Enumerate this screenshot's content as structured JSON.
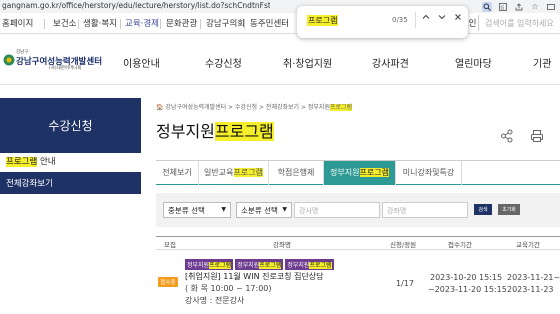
{
  "browser": {
    "url": "gangnam.go.kr/office/herstory/edu/lecture/herstory/list.do?schCndtnFstField=eci_crs_mlv&schCndtnFstValue=..."
  },
  "find_bar": {
    "query": "프로그램",
    "count": "0/35"
  },
  "top_nav": {
    "items": [
      "홈페이지",
      "보건소",
      "생활·복지",
      "교육·경제",
      "문화관광",
      "강남구의회",
      "동주민센터"
    ],
    "login": "로그인",
    "search_placeholder": "검색어를 입력하세요"
  },
  "logo": {
    "small": "강남구",
    "main": "강남구여성능력개발센터",
    "sub": "(사)대한어머니회"
  },
  "gnb": {
    "items": [
      "이용안내",
      "수강신청",
      "취·창업지원",
      "강사파견",
      "열린마당",
      "기관"
    ]
  },
  "sidebar": {
    "title": "수강신청",
    "items": [
      {
        "hl": "프로그램",
        "rest": " 안내"
      },
      {
        "label": "전체강좌보기"
      }
    ]
  },
  "breadcrumb": {
    "parts": [
      "강남구여성능력개발센터",
      "수강신청",
      "전체강좌보기",
      "정부지원"
    ],
    "hl": "프로그램"
  },
  "page": {
    "title_a": "정부지원",
    "title_b": "프로그램"
  },
  "tabs": [
    {
      "a": "전체보기",
      "b": ""
    },
    {
      "a": "일반교육",
      "b": "프로그램"
    },
    {
      "a": "학점은행제",
      "b": ""
    },
    {
      "a": "정부지원",
      "b": "프로그램"
    },
    {
      "a": "미니강좌및특강",
      "b": ""
    }
  ],
  "filter": {
    "category1": "중분류 선택",
    "category2": "소분류 선택",
    "lecture_placeholder": "강사명",
    "course_placeholder": "강좌명",
    "search_btn": "검색",
    "reset_btn": "초기화"
  },
  "table": {
    "headers": [
      "모집",
      "강좌명",
      "신청/정원",
      "접수기간",
      "교육기간"
    ],
    "row": {
      "tags": [
        {
          "a": "정부지원",
          "b": "프로그램"
        },
        {
          "a": "정부지원",
          "b": "프로그램"
        },
        {
          "a": "정부지원",
          "b": "프로그램"
        }
      ],
      "status": "접수중",
      "title": "[취업지원] 11월 WIN 진로코칭 집단상담",
      "schedule": "( 화 목 10:00 ~ 17:00)",
      "instructor": "강사명 : 전문강사",
      "enrollment": "1/17",
      "reg_start": "2023-10-20 15:15",
      "reg_end": "~2023-11-20 15:15",
      "edu_start": "2023-11-21~",
      "edu_end": "2023-11-23"
    }
  },
  "colors": {
    "navy": "#1f3266",
    "teal": "#2e9a96",
    "highlight": "#f5ee2b",
    "tag_purple": "#6d3b8f",
    "status_orange": "#f39b1d"
  }
}
